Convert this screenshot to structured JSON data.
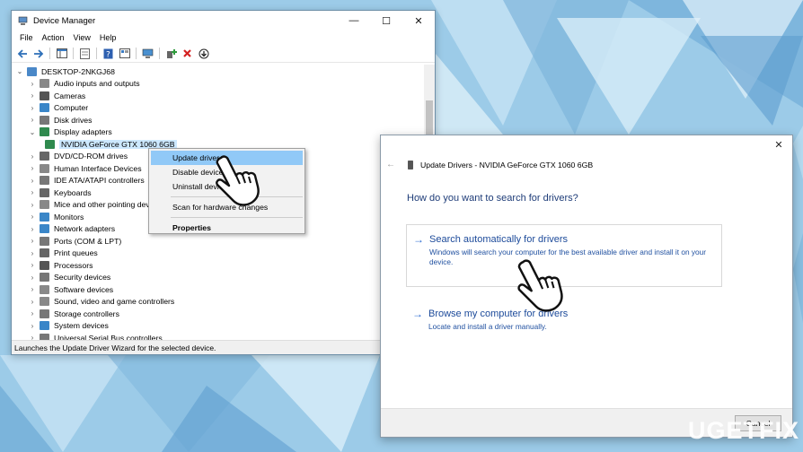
{
  "device_manager": {
    "title": "Device Manager",
    "menus": [
      "File",
      "Action",
      "View",
      "Help"
    ],
    "window_controls": {
      "minimize": "—",
      "maximize": "☐",
      "close": "✕"
    },
    "root": "DESKTOP-2NKGJ68",
    "tree": [
      {
        "label": "Audio inputs and outputs",
        "color": "#888"
      },
      {
        "label": "Cameras",
        "color": "#555"
      },
      {
        "label": "Computer",
        "color": "#3a86c8"
      },
      {
        "label": "Disk drives",
        "color": "#777"
      },
      {
        "label": "Display adapters",
        "color": "#2f8a4e",
        "expanded": true
      },
      {
        "label": "DVD/CD-ROM drives",
        "color": "#666"
      },
      {
        "label": "Human Interface Devices",
        "color": "#888"
      },
      {
        "label": "IDE ATA/ATAPI controllers",
        "color": "#777"
      },
      {
        "label": "Keyboards",
        "color": "#666"
      },
      {
        "label": "Mice and other pointing devices",
        "color": "#888"
      },
      {
        "label": "Monitors",
        "color": "#3a86c8"
      },
      {
        "label": "Network adapters",
        "color": "#3a86c8"
      },
      {
        "label": "Ports (COM & LPT)",
        "color": "#777"
      },
      {
        "label": "Print queues",
        "color": "#666"
      },
      {
        "label": "Processors",
        "color": "#555"
      },
      {
        "label": "Security devices",
        "color": "#777"
      },
      {
        "label": "Software devices",
        "color": "#888"
      },
      {
        "label": "Sound, video and game controllers",
        "color": "#888"
      },
      {
        "label": "Storage controllers",
        "color": "#777"
      },
      {
        "label": "System devices",
        "color": "#3a86c8"
      },
      {
        "label": "Universal Serial Bus controllers",
        "color": "#777"
      }
    ],
    "child_device": "NVIDIA GeForce GTX 1060 6GB",
    "status": "Launches the Update Driver Wizard for the selected device."
  },
  "context_menu": {
    "update_driver": "Update driver",
    "disable_device": "Disable device",
    "uninstall_device": "Uninstall device",
    "scan": "Scan for hardware changes",
    "properties": "Properties"
  },
  "update_dialog": {
    "header": "Update Drivers - NVIDIA GeForce GTX 1060 6GB",
    "question": "How do you want to search for drivers?",
    "option1_title": "Search automatically for drivers",
    "option1_desc": "Windows will search your computer for the best available driver and install it on your device.",
    "option2_title": "Browse my computer for drivers",
    "option2_desc": "Locate and install a driver manually.",
    "cancel": "Cancel",
    "close": "✕",
    "back": "←"
  },
  "watermark": {
    "text": "UG",
    "text2": "ETFIX"
  }
}
